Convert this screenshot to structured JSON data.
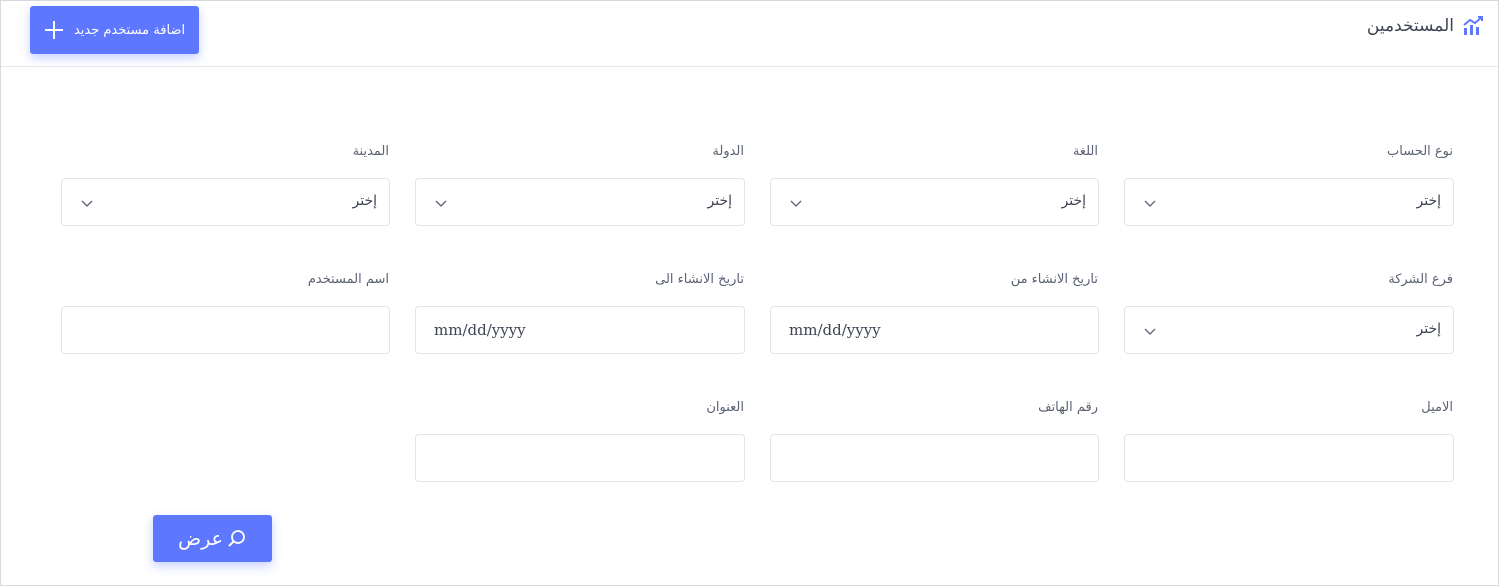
{
  "header": {
    "title": "المستخدمين",
    "title_icon": "chart-line-icon",
    "add_button_label": "اضافة مستخدم جديد",
    "add_button_icon": "plus-icon"
  },
  "filters": {
    "account_type": {
      "label": "نوع الحساب",
      "value": "إختر"
    },
    "language": {
      "label": "اللغة",
      "value": "إختر"
    },
    "country": {
      "label": "الدولة",
      "value": "إختر"
    },
    "city": {
      "label": "المدينة",
      "value": "إختر"
    },
    "company_branch": {
      "label": "فرع الشركة",
      "value": "إختر"
    },
    "created_from": {
      "label": "تاريخ الانشاء من",
      "value": "mm/dd/yyyy"
    },
    "created_to": {
      "label": "تاريخ الانشاء الى",
      "value": "mm/dd/yyyy"
    },
    "username": {
      "label": "اسم المستخدم",
      "value": ""
    },
    "email": {
      "label": "الاميل",
      "value": ""
    },
    "phone": {
      "label": "رقم الهاتف",
      "value": ""
    },
    "address": {
      "label": "العنوان",
      "value": ""
    }
  },
  "actions": {
    "show_label": "عرض",
    "show_icon": "search-icon"
  },
  "colors": {
    "accent": "#5d78ff",
    "border": "#e2e5ec",
    "label": "#5c6275"
  }
}
